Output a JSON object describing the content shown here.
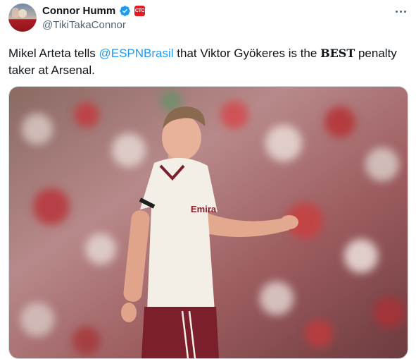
{
  "author": {
    "display_name": "Connor Humm",
    "handle": "@TikiTakaConnor",
    "flair_badge": "CTC"
  },
  "tweet": {
    "text_before": "Mikel Arteta tells ",
    "mention": "@ESPNBrasil",
    "text_middle": " that Viktor Gyökeres is the ",
    "emphasis": "BEST",
    "text_after": " penalty taker at Arsenal."
  },
  "media": {
    "kind": "photo",
    "shirt_lettering": "Emira"
  },
  "colors": {
    "verified": "#1d9bf0",
    "mention": "#1d9bf0",
    "shirt": "#f3efe7",
    "shorts": "#7a1f2b"
  },
  "icons": [
    "verified-badge-icon",
    "more-options-icon"
  ]
}
